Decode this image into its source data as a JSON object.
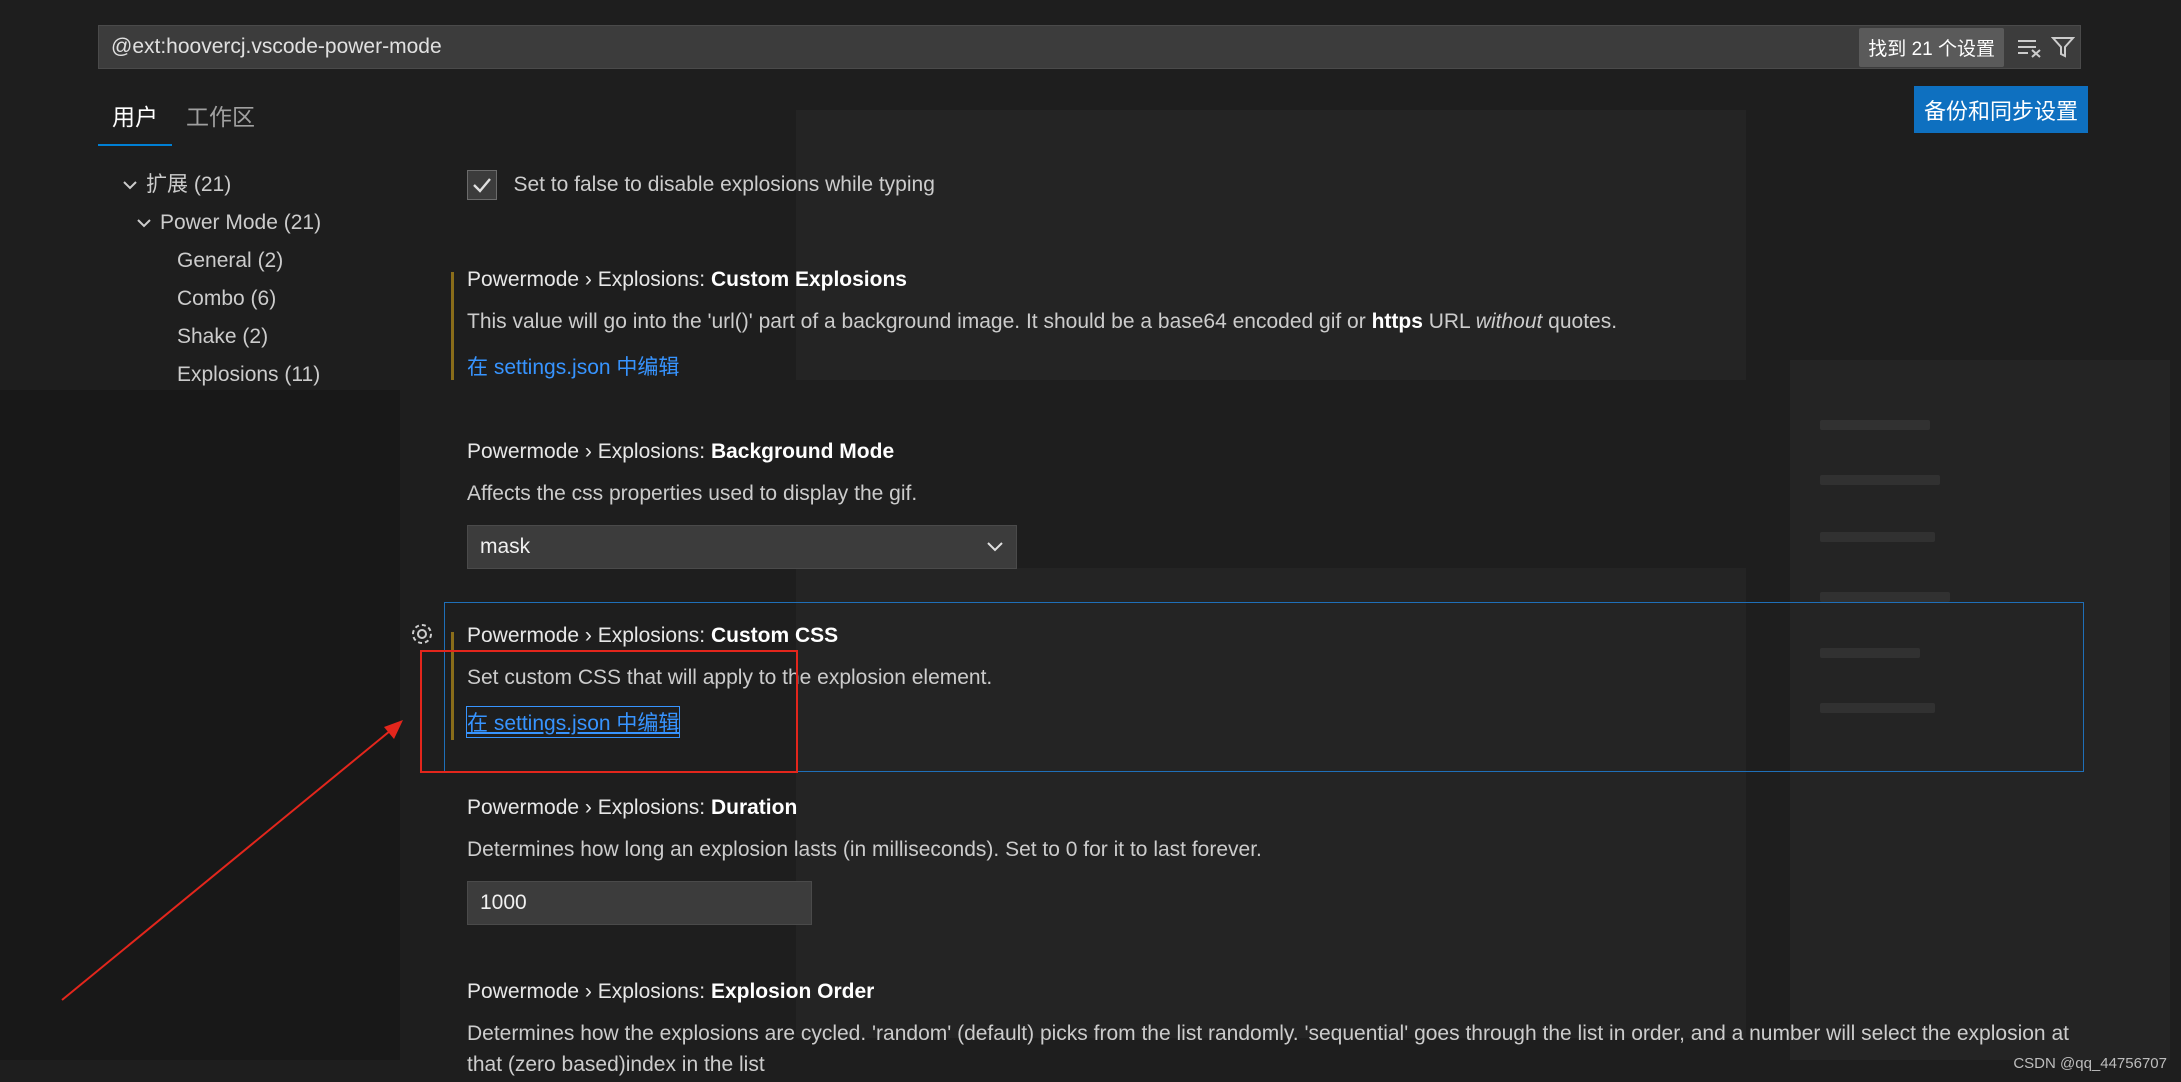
{
  "search": {
    "value": "@ext:hoovercj.vscode-power-mode",
    "results_badge": "找到 21 个设置"
  },
  "tabs": [
    {
      "label": "用户",
      "active": true
    },
    {
      "label": "工作区",
      "active": false
    }
  ],
  "sync_button": "备份和同步设置",
  "toc": {
    "items": [
      {
        "label": "扩展",
        "count": "(21)"
      },
      {
        "label": "Power Mode",
        "count": "(21)"
      },
      {
        "label": "General",
        "count": "(2)"
      },
      {
        "label": "Combo",
        "count": "(6)"
      },
      {
        "label": "Shake",
        "count": "(2)"
      },
      {
        "label": "Explosions",
        "count": "(11)"
      }
    ]
  },
  "settings": {
    "enabled_checkbox": {
      "checked": true,
      "label": "Set to false to disable explosions while typing"
    },
    "custom_explosions": {
      "prefix": "Powermode › Explosions: ",
      "name": "Custom Explosions",
      "desc_a": "This value will go into the 'url()' part of a background image. It should be a base64 encoded gif or ",
      "desc_b": "https",
      "desc_c": " URL ",
      "desc_d": "without",
      "desc_e": " quotes.",
      "link": "在 settings.json 中编辑"
    },
    "background_mode": {
      "prefix": "Powermode › Explosions: ",
      "name": "Background Mode",
      "desc": "Affects the css properties used to display the gif.",
      "value": "mask"
    },
    "custom_css": {
      "prefix": "Powermode › Explosions: ",
      "name": "Custom CSS",
      "desc": "Set custom CSS that will apply to the explosion element.",
      "link": "在 settings.json 中编辑"
    },
    "duration": {
      "prefix": "Powermode › Explosions: ",
      "name": "Duration",
      "desc": "Determines how long an explosion lasts (in milliseconds). Set to 0 for it to last forever.",
      "value": "1000"
    },
    "explosion_order": {
      "prefix": "Powermode › Explosions: ",
      "name": "Explosion Order",
      "desc": "Determines how the explosions are cycled. 'random' (default) picks from the list randomly. 'sequential' goes through the list in order, and a number will select the explosion at that (zero based)index in the list"
    }
  },
  "watermark": "CSDN @qq_44756707",
  "colors": {
    "accent": "#0e70c0",
    "link": "#3794ff",
    "annotation": "#e3261c",
    "modified": "#8a6d1a"
  }
}
